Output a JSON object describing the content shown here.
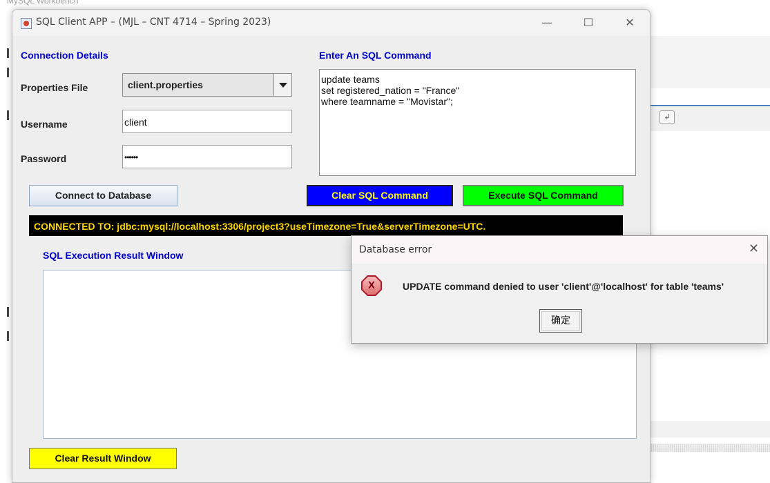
{
  "background": {
    "caption": "MySQL Workbench",
    "tool_icon": "wrap-icon"
  },
  "window": {
    "title": "SQL Client APP – (MJL – CNT 4714 – Spring 2023)",
    "minimize": "—",
    "maximize": "☐",
    "close": "✕"
  },
  "connection": {
    "section_label": "Connection Details",
    "properties_label": "Properties File",
    "properties_value": "client.properties",
    "username_label": "Username",
    "username_value": "client",
    "password_label": "Password",
    "password_value": "••••••",
    "connect_button": "Connect to Database"
  },
  "sql": {
    "section_label": "Enter An SQL Command",
    "command_text": "update teams\nset registered_nation = \"France\"\nwhere teamname = \"Movistar\";",
    "clear_button": "Clear SQL Command",
    "execute_button": "Execute SQL Command"
  },
  "status": {
    "text": "CONNECTED TO: jdbc:mysql://localhost:3306/project3?useTimezone=True&serverTimezone=UTC."
  },
  "result": {
    "section_label": "SQL Execution Result Window",
    "clear_button": "Clear Result Window"
  },
  "dialog": {
    "title": "Database error",
    "close": "✕",
    "icon_glyph": "X",
    "message": "UPDATE command denied to user 'client'@'localhost' for table 'teams'",
    "ok_button": "确定"
  },
  "colors": {
    "section_label": "#0000cc",
    "clear_sql_bg": "#0000ff",
    "clear_sql_text": "#ffff00",
    "execute_bg": "#00ff00",
    "status_bg": "#000000",
    "status_text": "#ffd700",
    "clear_result_bg": "#ffff00"
  }
}
